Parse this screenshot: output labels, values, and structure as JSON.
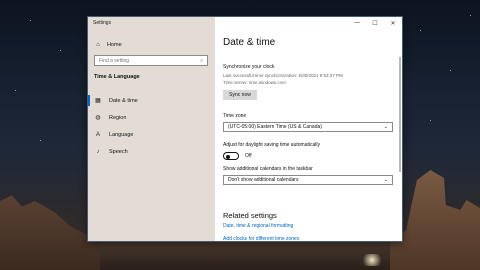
{
  "window": {
    "title": "Settings",
    "controls": [
      "—",
      "☐",
      "✕"
    ]
  },
  "sidebar": {
    "home_label": "Home",
    "search_placeholder": "Find a setting",
    "section_title": "Time & Language",
    "items": [
      {
        "label": "Date & time",
        "icon": "calendar-icon",
        "active": true
      },
      {
        "label": "Region",
        "icon": "globe-icon",
        "active": false
      },
      {
        "label": "Language",
        "icon": "language-icon",
        "active": false
      },
      {
        "label": "Speech",
        "icon": "microphone-icon",
        "active": false
      }
    ]
  },
  "main": {
    "title": "Date & time",
    "sync_heading": "Synchronize your clock",
    "last_sync": "Last successful time synchronization: 5/30/2021 9:53:37 PM",
    "time_server": "Time server: time.windows.com",
    "sync_button": "Sync now",
    "timezone_label": "Time zone",
    "timezone_value": "(UTC-05:00) Eastern Time (US & Canada)",
    "dst_label": "Adjust for daylight saving time automatically",
    "dst_state": "Off",
    "calendars_label": "Show additional calendars in the taskbar",
    "calendars_value": "Don't show additional calendars",
    "related_title": "Related settings",
    "related_links": [
      "Date, time & regional formatting",
      "Add clocks for different time zones"
    ]
  },
  "colors": {
    "accent": "#0067c0"
  }
}
